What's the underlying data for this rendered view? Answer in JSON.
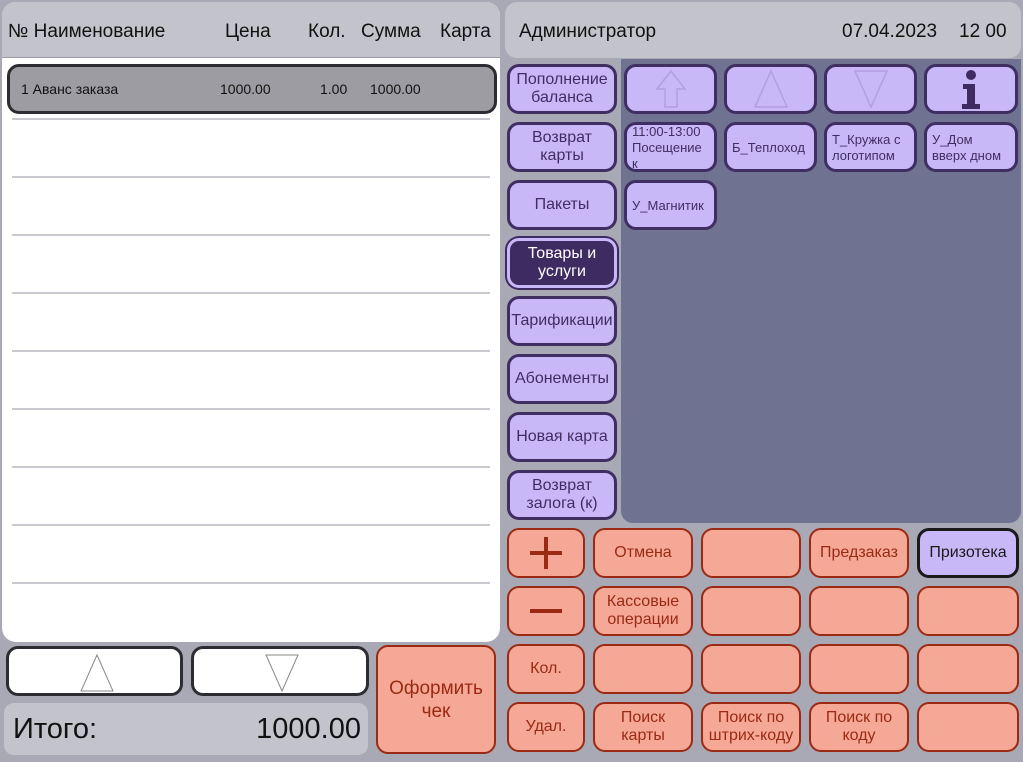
{
  "receipt": {
    "columns": [
      "№ Наименование",
      "Цена",
      "Кол.",
      "Сумма",
      "Карта"
    ],
    "rows": [
      {
        "num_name": "1 Аванс заказа",
        "price": "1000.00",
        "qty": "1.00",
        "sum": "1000.00",
        "card": ""
      }
    ]
  },
  "total": {
    "label": "Итого:",
    "value": "1000.00"
  },
  "checkout_label": "Оформить\nчек",
  "header": {
    "user": "Администратор",
    "date": "07.04.2023",
    "time": "12 00"
  },
  "categories": [
    "Пополнение\nбаланса",
    "Возврат\nкарты",
    "Пакеты",
    "Товары и\nуслуги",
    "Тарификации",
    "Абонементы",
    "Новая карта",
    "Возврат\nзалога (к)"
  ],
  "active_category_index": 3,
  "goods": [
    "11:00-13:00\nПосещение к",
    "Б_Теплоход",
    "Т_Кружка с\nлоготипом",
    "У_Дом\nвверх дном",
    "У_Магнитик"
  ],
  "nav_icons": [
    "home-up-arrow-icon",
    "up-arrow-icon",
    "down-arrow-icon",
    "info-icon"
  ],
  "keypad": {
    "row1": [
      "+",
      "Отмена",
      "",
      "Предзаказ",
      "Призотека"
    ],
    "row2": [
      "−",
      "Кассовые\nоперации",
      "",
      "",
      ""
    ],
    "row3": [
      "Кол.",
      "",
      "",
      "",
      ""
    ],
    "row4": [
      "Удал.",
      "Поиск\nкарты",
      "Поиск по\nштрих-коду",
      "Поиск по\nкоду",
      ""
    ]
  },
  "colors": {
    "accent_orange": "#f6a896",
    "accent_orange_border": "#9a2a14",
    "accent_purple": "#c9b8f8",
    "accent_purple_dark": "#3e2b61",
    "goods_panel": "#707292"
  }
}
